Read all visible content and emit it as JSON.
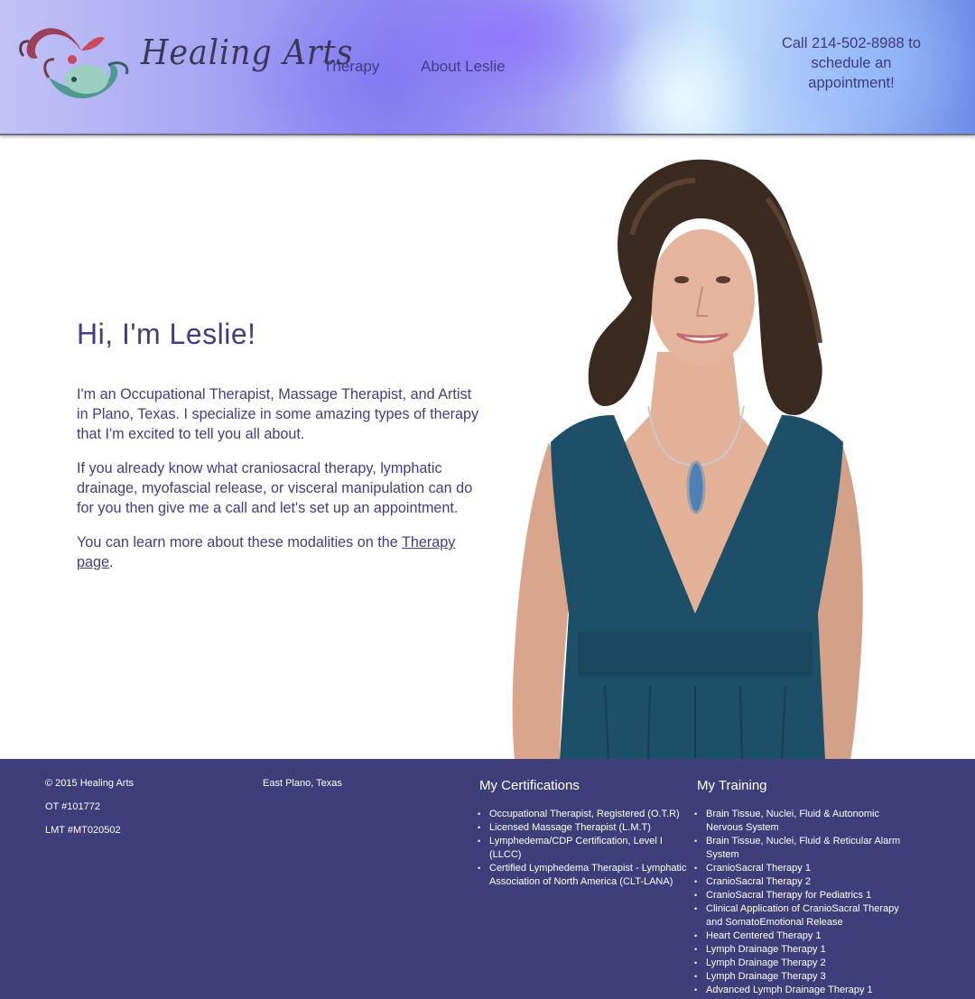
{
  "header": {
    "logo_text": "Healing Arts",
    "nav": [
      {
        "label": "Therapy"
      },
      {
        "label": "About Leslie"
      }
    ],
    "call_text": "Call 214-502-8988 to schedule an appointment!"
  },
  "main": {
    "heading": "Hi, I'm Leslie!",
    "para1": "I'm an Occupational Therapist, Massage Therapist, and Artist in Plano, Texas. I specialize in some amazing types of therapy that I'm excited to tell you all about.",
    "para2": "If you already know what craniosacral therapy, lymphatic drainage, myofascial release, or visceral manipulation can do for you then give me a call and let's set up an appointment.",
    "para3_before": "You can learn more about these modalities on the ",
    "para3_link": "Therapy page",
    "para3_after": "."
  },
  "footer": {
    "copyright": "© 2015 Healing Arts",
    "ot_license": "OT #101772",
    "lmt_license": "LMT #MT020502",
    "location": "East Plano, Texas",
    "certifications_heading": "My Certifications",
    "certifications": [
      "Occupational Therapist, Registered (O.T.R)",
      "Licensed Massage Therapist (L.M.T)",
      "Lymphedema/CDP Certification, Level I (LLCC)",
      "Certified Lymphedema Therapist - Lymphatic Association of North America (CLT-LANA)"
    ],
    "training_heading": "My Training",
    "training": [
      "Brain Tissue, Nuclei, Fluid & Autonomic Nervous System",
      "Brain Tissue, Nuclei, Fluid & Reticular Alarm System",
      "CranioSacral Therapy 1",
      "CranioSacral Therapy 2",
      "CranioSacral Therapy for Pediatrics 1",
      "Clinical Application of CranioSacral Therapy and SomatoEmotional Release",
      "Heart Centered Therapy 1",
      "Lymph Drainage Therapy 1",
      "Lymph Drainage Therapy 2",
      "Lymph Drainage Therapy 3",
      "Advanced Lymph Drainage Therapy 1"
    ]
  },
  "colors": {
    "text_purple": "#433c82",
    "footer_bg": "#3e3e7b",
    "dress_teal": "#1d5068"
  }
}
